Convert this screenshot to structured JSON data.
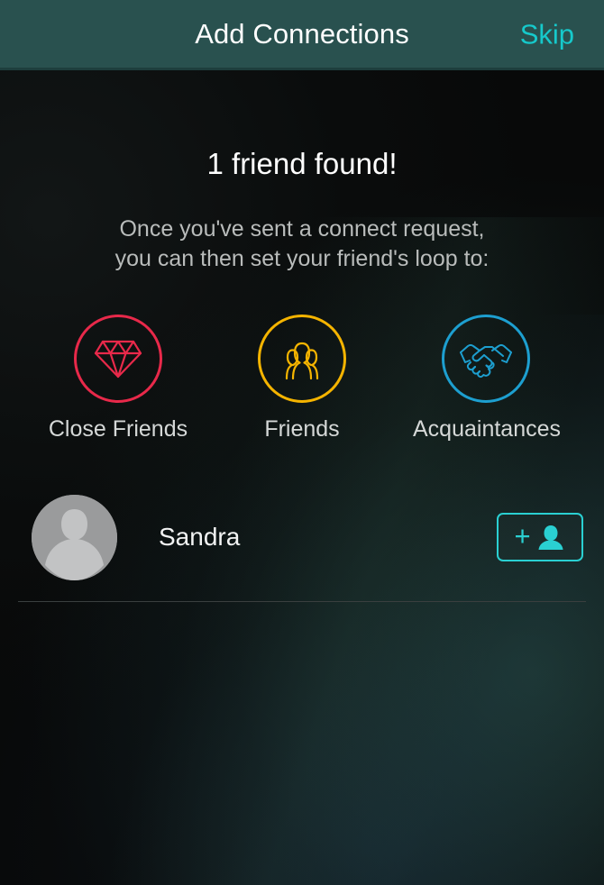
{
  "header": {
    "title": "Add Connections",
    "skip_label": "Skip",
    "background_color": "#29514f",
    "skip_color": "#16c9cb"
  },
  "main": {
    "headline": "1 friend found!",
    "subtitle_line1": "Once you've sent a connect request,",
    "subtitle_line2": "you can then set your friend's loop to:",
    "loops": [
      {
        "label": "Close Friends",
        "icon": "diamond-icon",
        "color": "#e8294a"
      },
      {
        "label": "Friends",
        "icon": "people-icon",
        "color": "#f5b400"
      },
      {
        "label": "Acquaintances",
        "icon": "handshake-icon",
        "color": "#1d9fd0"
      }
    ]
  },
  "friends": [
    {
      "name": "Sandra",
      "avatar": "default-avatar",
      "add_button": {
        "plus": "+",
        "icon": "person-icon",
        "color": "#2ad0d2"
      }
    }
  ]
}
